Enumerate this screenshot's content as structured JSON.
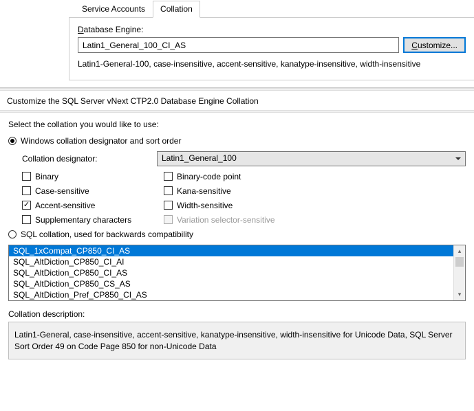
{
  "top": {
    "tabs": {
      "service_accounts": "Service Accounts",
      "collation": "Collation"
    },
    "db_engine_label": "Database Engine:",
    "collation_value": "Latin1_General_100_CI_AS",
    "customize_btn": "ustomize...",
    "customize_prefix": "C",
    "description": "Latin1-General-100, case-insensitive, accent-sensitive, kanatype-insensitive, width-insensitive"
  },
  "dialog_title": "Customize the SQL Server vNext CTP2.0 Database Engine Collation",
  "prompt": "Select the collation you would like to use:",
  "radio_windows": "Windows collation designator and sort order",
  "radio_sql": "SQL collation, used for backwards compatibility",
  "designator": {
    "label": "Collation designator:",
    "value": "Latin1_General_100"
  },
  "checks": {
    "binary": "Binary",
    "binary_code_point": "Binary-code point",
    "case_sensitive": "Case-sensitive",
    "kana_sensitive": "Kana-sensitive",
    "accent_sensitive": "Accent-sensitive",
    "width_sensitive": "Width-sensitive",
    "supplementary": "Supplementary characters",
    "variation_selector": "Variation selector-sensitive"
  },
  "sql_list": [
    "SQL_1xCompat_CP850_CI_AS",
    "SQL_AltDiction_CP850_CI_AI",
    "SQL_AltDiction_CP850_CI_AS",
    "SQL_AltDiction_CP850_CS_AS",
    "SQL_AltDiction_Pref_CP850_CI_AS"
  ],
  "desc": {
    "label": "Collation description:",
    "text": "Latin1-General, case-insensitive, accent-sensitive, kanatype-insensitive, width-insensitive for Unicode Data, SQL Server Sort Order 49 on Code Page 850 for non-Unicode Data"
  }
}
